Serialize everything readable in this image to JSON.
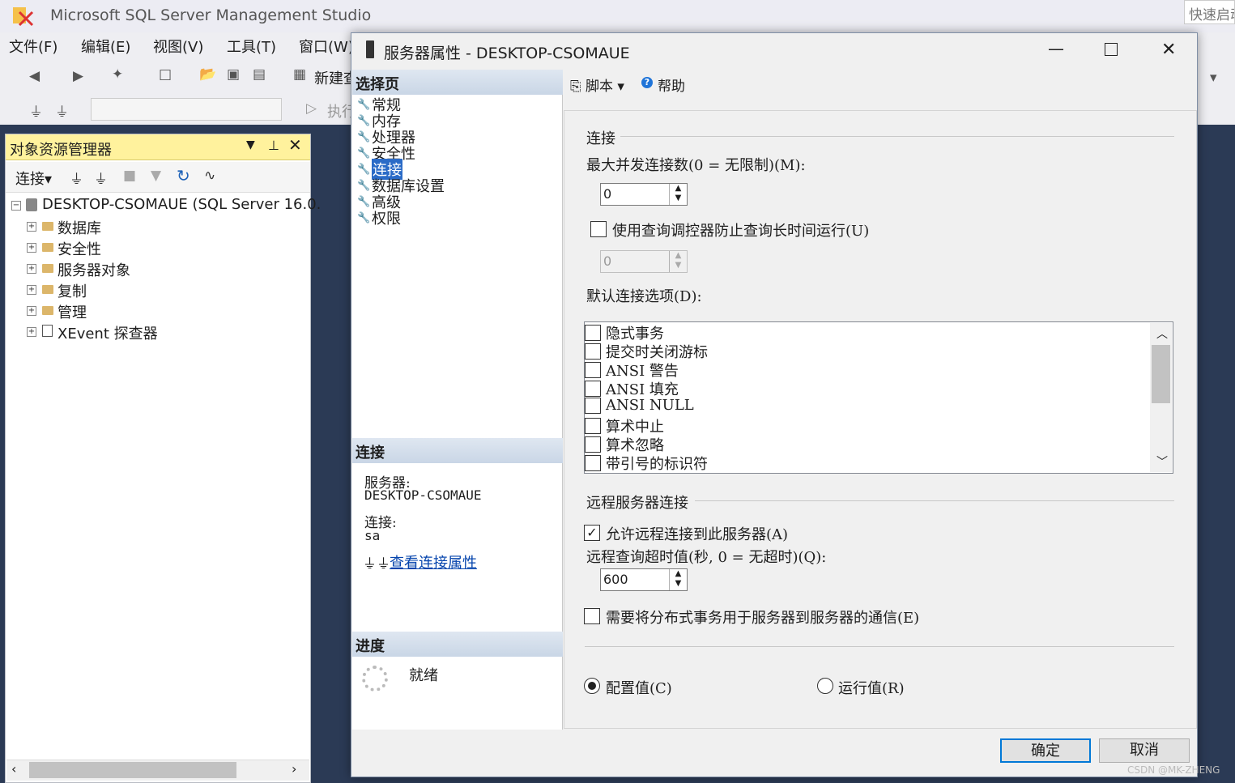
{
  "app": {
    "title": "Microsoft SQL Server Management Studio",
    "quick_launch": "快速启动"
  },
  "menu": [
    "文件(F)",
    "编辑(E)",
    "视图(V)",
    "工具(T)",
    "窗口(W)"
  ],
  "toolbar": {
    "new_query": "新建查询",
    "execute": "执行"
  },
  "object_explorer": {
    "title": "对象资源管理器",
    "connect": "连接",
    "server": "DESKTOP-CSOMAUE (SQL Server 16.0.",
    "nodes": [
      "数据库",
      "安全性",
      "服务器对象",
      "复制",
      "管理",
      "XEvent 探查器"
    ]
  },
  "dialog": {
    "title": "服务器属性 - DESKTOP-CSOMAUE",
    "select_page": "选择页",
    "pages": [
      "常规",
      "内存",
      "处理器",
      "安全性",
      "连接",
      "数据库设置",
      "高级",
      "权限"
    ],
    "selected_page": "连接",
    "conn_section": "连接",
    "server_label": "服务器:",
    "server_value": "DESKTOP-CSOMAUE",
    "connection_label": "连接:",
    "connection_value": "sa",
    "view_conn_props": "查看连接属性",
    "progress_section": "进度",
    "progress_status": "就绪",
    "script": "脚本",
    "help": "帮助",
    "group_connections": "连接",
    "max_conn_label": "最大并发连接数(0 = 无限制)(M):",
    "max_conn_value": "0",
    "use_governor_label": "使用查询调控器防止查询长时间运行(U)",
    "use_governor_checked": false,
    "governor_value": "0",
    "default_options_label": "默认连接选项(D):",
    "default_options": [
      "隐式事务",
      "提交时关闭游标",
      "ANSI 警告",
      "ANSI 填充",
      "ANSI NULL",
      "算术中止",
      "算术忽略",
      "带引号的标识符"
    ],
    "group_remote": "远程服务器连接",
    "allow_remote_label": "允许远程连接到此服务器(A)",
    "allow_remote_checked": true,
    "remote_timeout_label": "远程查询超时值(秒, 0 = 无超时)(Q):",
    "remote_timeout_value": "600",
    "require_dtc_label": "需要将分布式事务用于服务器到服务器的通信(E)",
    "require_dtc_checked": false,
    "radio_config": "配置值(C)",
    "radio_running": "运行值(R)",
    "selected_radio": "config",
    "ok": "确定",
    "cancel": "取消"
  },
  "watermark": "CSDN @MK-ZHENG"
}
